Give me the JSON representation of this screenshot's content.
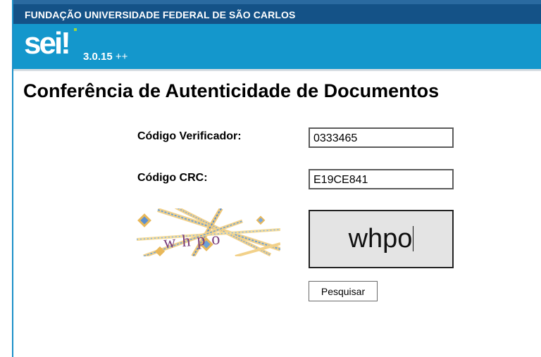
{
  "header": {
    "organization": "FUNDAÇÃO UNIVERSIDADE FEDERAL DE SÃO CARLOS",
    "logo_text": "sei!",
    "version": "3.0.15",
    "version_suffix": "++"
  },
  "page": {
    "title": "Conferência de Autenticidade de Documentos"
  },
  "form": {
    "verifier_label": "Código Verificador:",
    "verifier_value": "0333465",
    "crc_label": "Código CRC:",
    "crc_value": "E19CE841",
    "captcha_image_text": "whpo",
    "captcha_input_value": "whpo",
    "search_button_label": "Pesquisar"
  },
  "colors": {
    "top_bar": "#145287",
    "brand_bar": "#1497cc",
    "logo_accent": "#9fd43c"
  }
}
